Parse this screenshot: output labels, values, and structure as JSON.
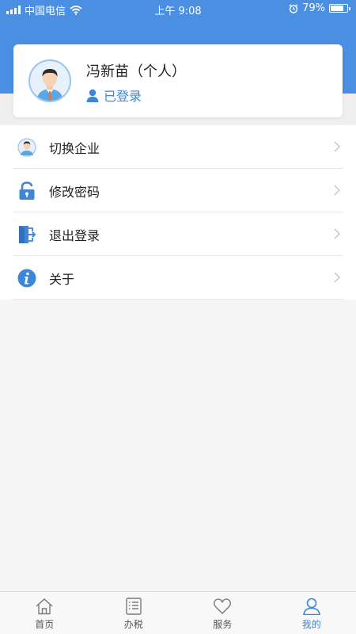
{
  "status_bar": {
    "carrier": "中国电信",
    "time": "上午 9:08",
    "battery": "79%",
    "battery_level": 0.79
  },
  "profile": {
    "name": "冯新苗（个人）",
    "status": "已登录"
  },
  "menu": {
    "items": [
      {
        "label": "切换企业",
        "icon": "avatar-icon"
      },
      {
        "label": "修改密码",
        "icon": "lock-icon"
      },
      {
        "label": "退出登录",
        "icon": "logout-door-icon"
      },
      {
        "label": "关于",
        "icon": "info-icon"
      }
    ]
  },
  "tabbar": {
    "tabs": [
      {
        "label": "首页",
        "icon": "home-icon",
        "active": false
      },
      {
        "label": "办税",
        "icon": "list-icon",
        "active": false
      },
      {
        "label": "服务",
        "icon": "heart-icon",
        "active": false
      },
      {
        "label": "我的",
        "icon": "user-icon",
        "active": true
      }
    ]
  },
  "colors": {
    "primary": "#4a8fe2",
    "accent": "#3d86d8",
    "text": "#222222",
    "background": "#f5f5f5"
  }
}
